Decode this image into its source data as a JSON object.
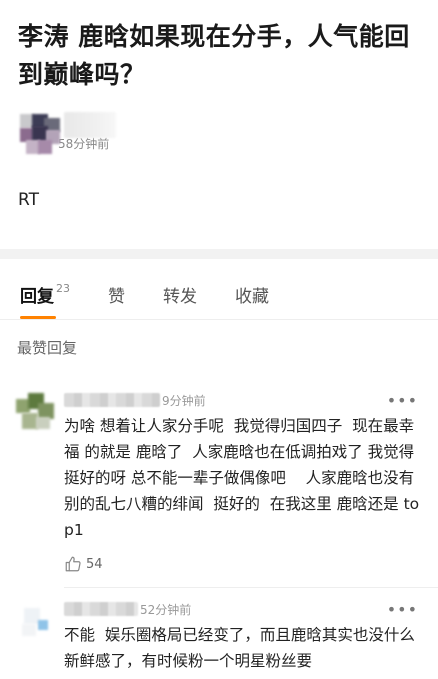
{
  "post": {
    "title": "李涛 鹿晗如果现在分手，人气能回到巅峰吗？",
    "time": "58分钟前",
    "body": "RT"
  },
  "tabs": [
    {
      "label": "回复",
      "count": "23",
      "active": true
    },
    {
      "label": "赞"
    },
    {
      "label": "转发"
    },
    {
      "label": "收藏"
    }
  ],
  "section_title": "最赞回复",
  "comments": [
    {
      "time": "9分钟前",
      "text": "为啥 想着让人家分手呢  我觉得归国四子  现在最幸福 的就是 鹿晗了  人家鹿晗也在低调拍戏了 我觉得挺好的呀 总不能一辈子做偶像吧    人家鹿晗也没有别的乱七八糟的绯闻  挺好的  在我这里 鹿晗还是 top1",
      "likes": "54",
      "more": "•••"
    },
    {
      "time": "52分钟前",
      "text": "不能  娱乐圈格局已经变了，而且鹿晗其实也没什么新鲜感了，有时候粉一个明星粉丝要",
      "more": "•••"
    }
  ],
  "icons": {
    "like": "thumbs-up-icon",
    "more": "more-dots-icon"
  },
  "colors": {
    "accent": "#ff8200"
  }
}
